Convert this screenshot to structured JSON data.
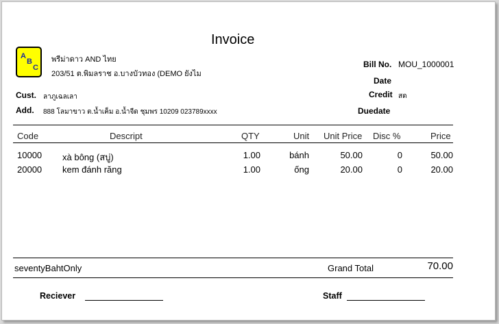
{
  "invoice": {
    "title": "Invoice",
    "logo_letters": [
      "A",
      "B",
      "C"
    ],
    "company_name": "พรีม่าดาว AND ไทย",
    "company_address": "203/51 ต.พิมลราช อ.บางบัวทอง (DEMO ยังไม",
    "bill_no_label": "Bill No.",
    "bill_no_value": "MOU_1000001",
    "date_label": "Date",
    "credit_label": "Credit",
    "credit_value": "สด",
    "duedate_label": "Duedate",
    "cust_label": "Cust.",
    "cust_value": "ลาภูเฉลเลา",
    "add_label": "Add.",
    "add_value": "888 โลมาขาว ต.น้ำเค็ม อ.น้ำจืด ชุมพร 10209 023789xxxx"
  },
  "table": {
    "headers": {
      "code": "Code",
      "descript": "Descript",
      "qty": "QTY",
      "unit": "Unit",
      "unit_price": "Unit Price",
      "disc": "Disc %",
      "price": "Price"
    },
    "rows": [
      {
        "code": "10000",
        "descript": "xà bông (สบู่)",
        "qty": "1.00",
        "unit": "bánh",
        "unit_price": "50.00",
        "disc": "0",
        "price": "50.00"
      },
      {
        "code": "20000",
        "descript": "kem đánh răng",
        "qty": "1.00",
        "unit": "ống",
        "unit_price": "20.00",
        "disc": "0",
        "price": "20.00"
      }
    ]
  },
  "footer": {
    "amount_words": "seventyBahtOnly",
    "grand_total_label": "Grand Total",
    "grand_total_value": "70.00",
    "receiver_label": "Reciever",
    "staff_label": "Staff"
  },
  "colors": {
    "logo_bg": "#ffff00",
    "logo_text": "#1a2a9a"
  }
}
